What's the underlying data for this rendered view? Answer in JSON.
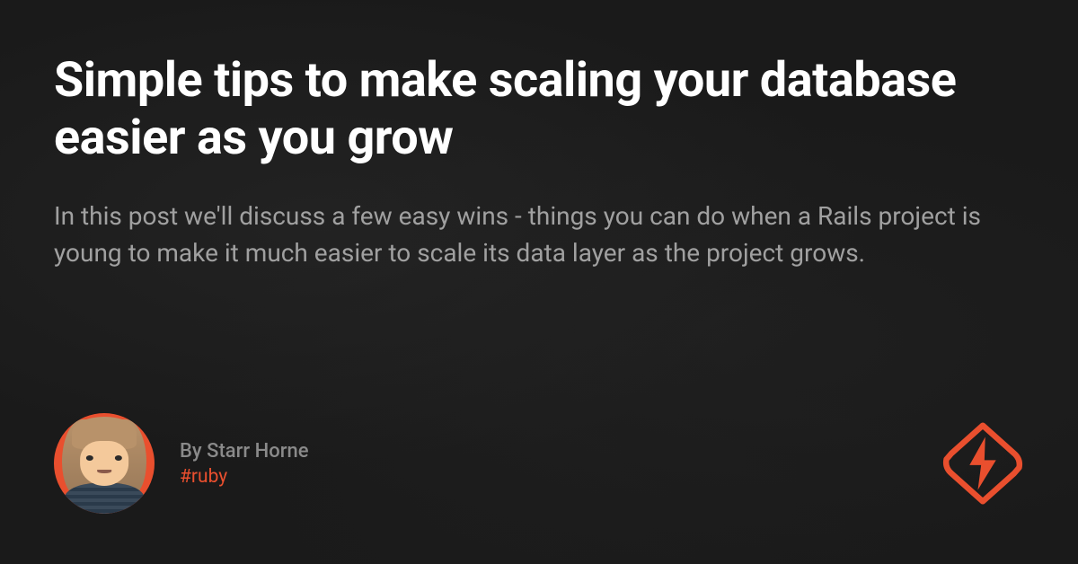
{
  "title": "Simple tips to make scaling your database easier as you grow",
  "description": "In this post we'll discuss a few easy wins - things you can do when a Rails project is young to make it much easier to scale its data layer as the project grows.",
  "author": {
    "byline": "By Starr Horne",
    "tag": "#ruby"
  },
  "colors": {
    "accent": "#e94f2e",
    "background": "#1a1a1a",
    "text_primary": "#ffffff",
    "text_secondary": "#a0a0a0",
    "text_muted": "#8a8a8a"
  }
}
